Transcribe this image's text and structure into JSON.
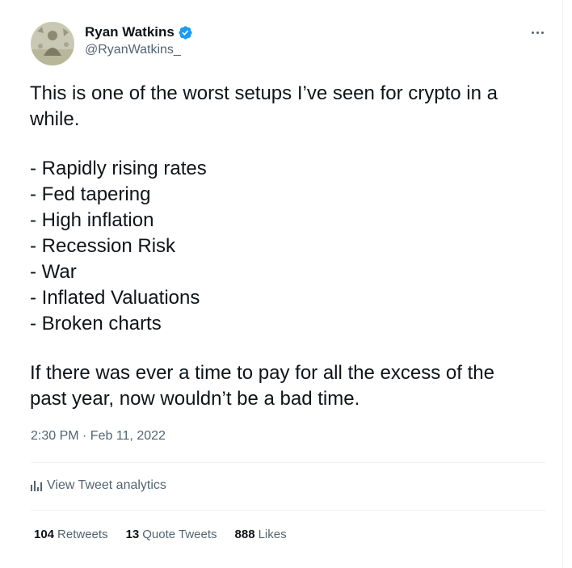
{
  "author": {
    "display_name": "Ryan Watkins",
    "handle": "@RyanWatkins_",
    "verified_icon": "verified-badge-icon",
    "avatar_icon": "avatar"
  },
  "tweet": {
    "lines_p1": [
      "This is one of the worst setups I’ve seen for crypto in a",
      "while."
    ],
    "list": [
      "- Rapidly rising rates",
      "- Fed tapering",
      "- High inflation",
      "- Recession Risk",
      "- War",
      "- Inflated Valuations",
      "- Broken charts"
    ],
    "lines_p3": [
      "If there was ever a time to pay for all the excess of the",
      "past year, now wouldn’t be a bad time."
    ],
    "timestamp": "2:30 PM · Feb 11, 2022"
  },
  "analytics": {
    "label": "View Tweet analytics",
    "icon": "analytics-icon"
  },
  "stats": {
    "retweets_count": "104",
    "retweets_label": "Retweets",
    "quotes_count": "13",
    "quotes_label": "Quote Tweets",
    "likes_count": "888",
    "likes_label": "Likes"
  },
  "colors": {
    "text": "#0f1419",
    "secondary": "#536471",
    "verified": "#1d9bf0",
    "divider": "#eff3f4"
  }
}
